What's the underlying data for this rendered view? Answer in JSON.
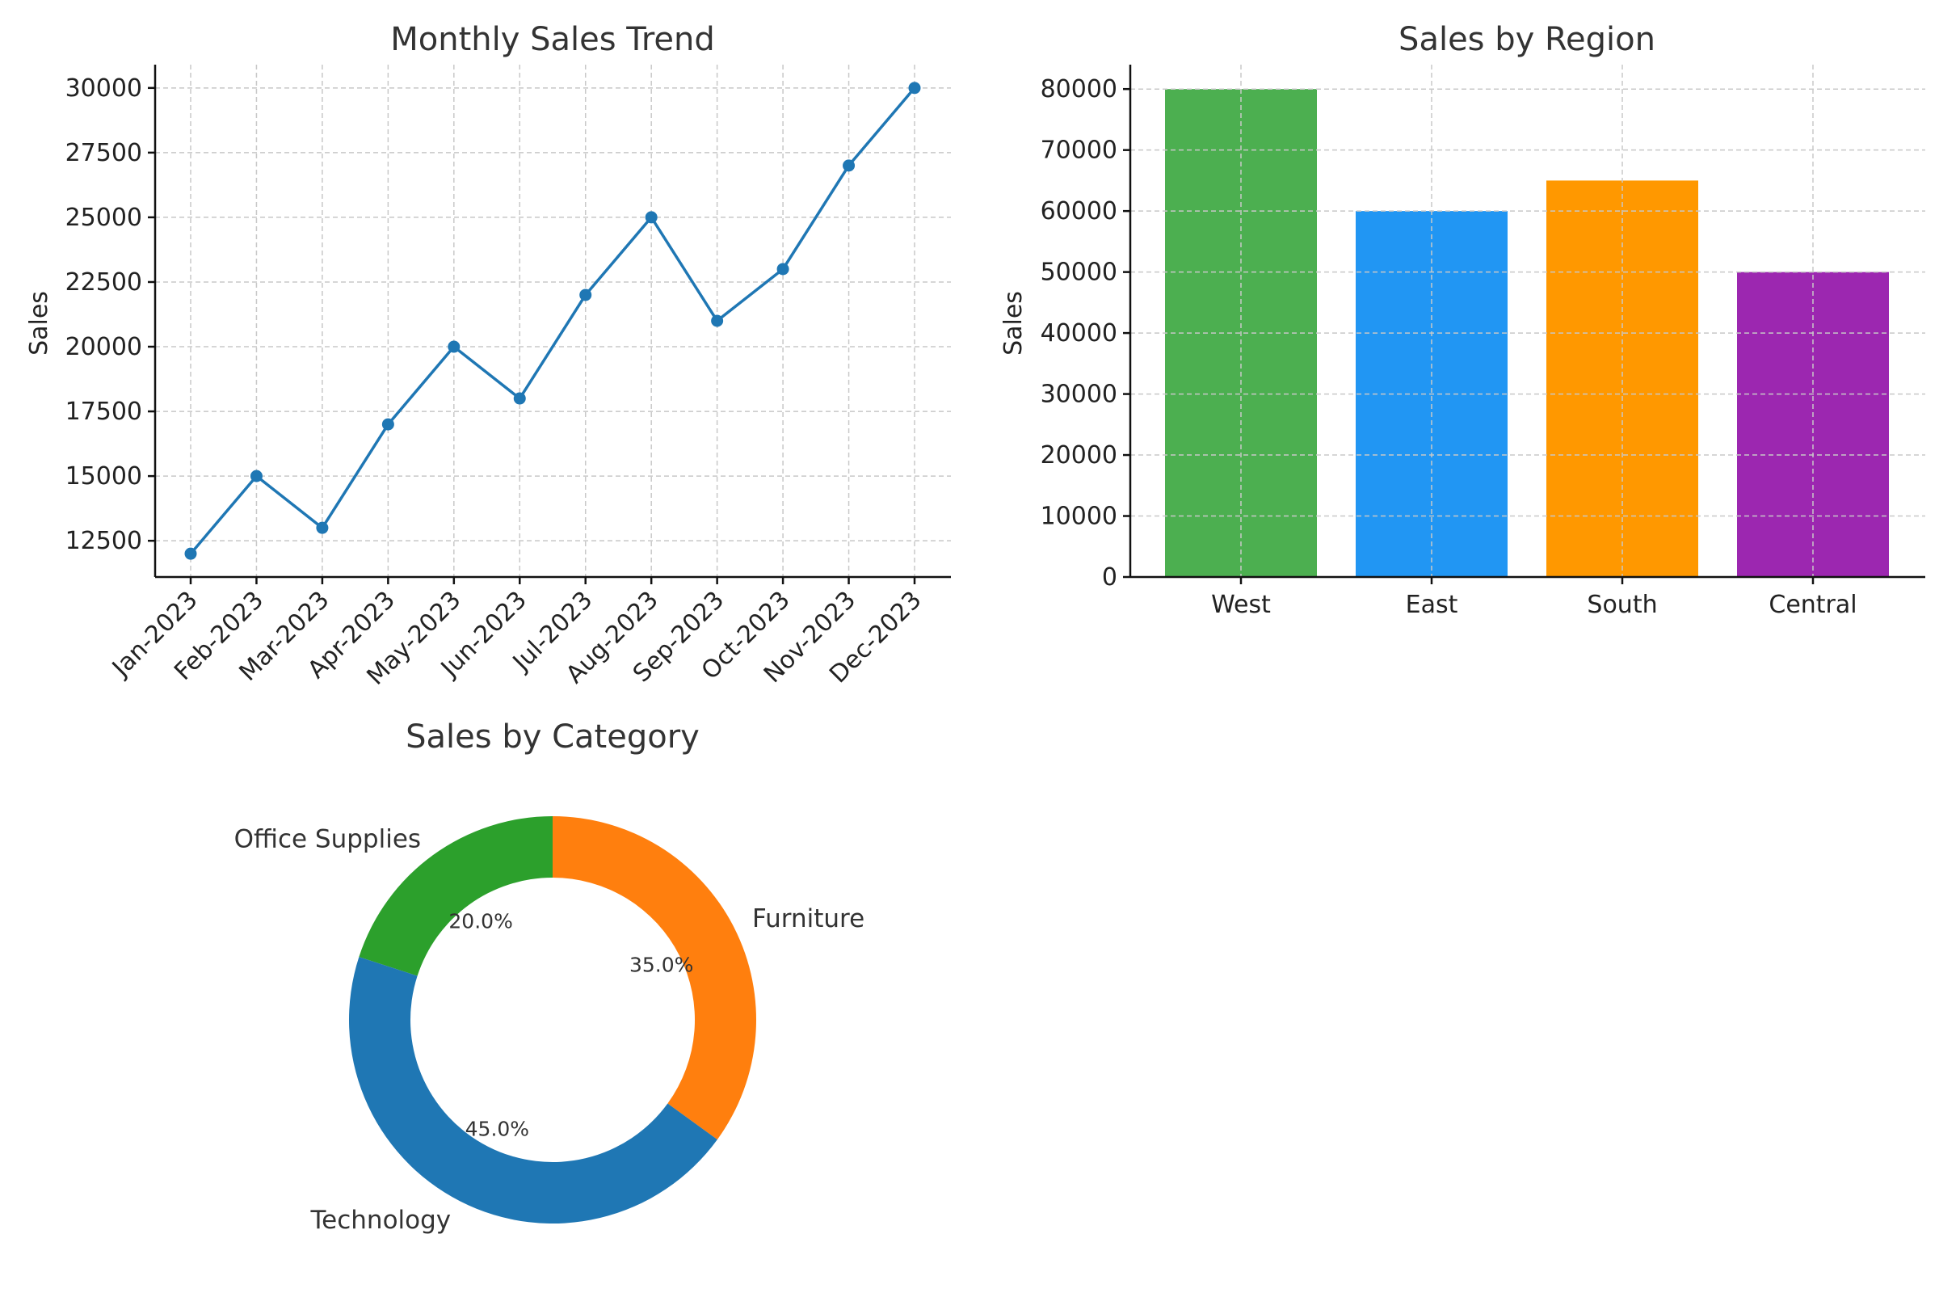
{
  "chart_data": [
    {
      "type": "line",
      "title": "Monthly Sales Trend",
      "xlabel": "",
      "ylabel": "Sales",
      "categories": [
        "Jan-2023",
        "Feb-2023",
        "Mar-2023",
        "Apr-2023",
        "May-2023",
        "Jun-2023",
        "Jul-2023",
        "Aug-2023",
        "Sep-2023",
        "Oct-2023",
        "Nov-2023",
        "Dec-2023"
      ],
      "values": [
        12000,
        15000,
        13000,
        17000,
        20000,
        18000,
        22000,
        25000,
        21000,
        23000,
        27000,
        30000
      ],
      "yticks": [
        12500,
        15000,
        17500,
        20000,
        22500,
        25000,
        27500,
        30000
      ],
      "ylim": [
        11100,
        30900
      ],
      "grid": true,
      "color": "#1f77b4"
    },
    {
      "type": "bar",
      "title": "Sales by Region",
      "xlabel": "",
      "ylabel": "Sales",
      "categories": [
        "West",
        "East",
        "South",
        "Central"
      ],
      "values": [
        80000,
        60000,
        65000,
        50000
      ],
      "colors": [
        "#4caf50",
        "#2196f3",
        "#ff9800",
        "#9c27b0"
      ],
      "yticks": [
        0,
        10000,
        20000,
        30000,
        40000,
        50000,
        60000,
        70000,
        80000
      ],
      "ylim": [
        0,
        84000
      ],
      "grid": true
    },
    {
      "type": "pie",
      "title": "Sales by Category",
      "labels": [
        "Furniture",
        "Office Supplies",
        "Technology"
      ],
      "values": [
        35.0,
        20.0,
        45.0
      ],
      "percent_labels": [
        "35.0%",
        "20.0%",
        "45.0%"
      ],
      "colors": [
        "#ff7f0e",
        "#2ca02c",
        "#1f77b4"
      ],
      "donut": true
    }
  ]
}
